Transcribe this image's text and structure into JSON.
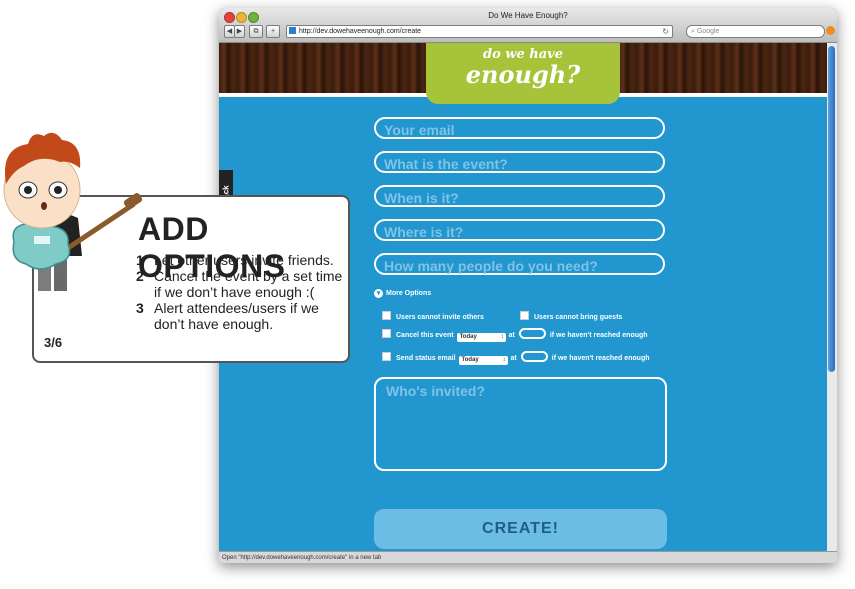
{
  "browser": {
    "title": "Do We Have Enough?",
    "url": "http://dev.dowehaveenough.com/create",
    "search_placeholder": "Google",
    "status_text": "Open \"http://dev.dowehaveenough.com/create\" in a new tab"
  },
  "logo": {
    "line1": "do we have",
    "line2": "enough?"
  },
  "feedback_tab": "back",
  "form": {
    "email_placeholder": "Your email",
    "event_placeholder": "What is the event?",
    "when_placeholder": "When is it?",
    "where_placeholder": "Where is it?",
    "people_placeholder": "How many people do you need?",
    "more_options_label": "More Options",
    "option_no_invite": "Users cannot invite others",
    "option_no_guests": "Users cannot bring guests",
    "option_cancel": "Cancel this event",
    "option_status": "Send status email",
    "select_value": "Today",
    "at_label": "at",
    "not_enough_label": "if we haven't reached enough",
    "invited_placeholder": "Who's invited?",
    "create_label": "CREATE!"
  },
  "callout": {
    "title": "ADD OPTIONS",
    "items": [
      {
        "num": "1",
        "text": "Let other users invite friends."
      },
      {
        "num": "2",
        "text": "Cancel the event by a set time if we don’t have enough  :("
      },
      {
        "num": "3",
        "text": "Alert attendees/users if we don’t have enough."
      }
    ],
    "counter": "3/6"
  },
  "colors": {
    "page_bg": "#2196cf",
    "logo_bg": "#a7c33a",
    "create_bg": "#6bbde6"
  }
}
